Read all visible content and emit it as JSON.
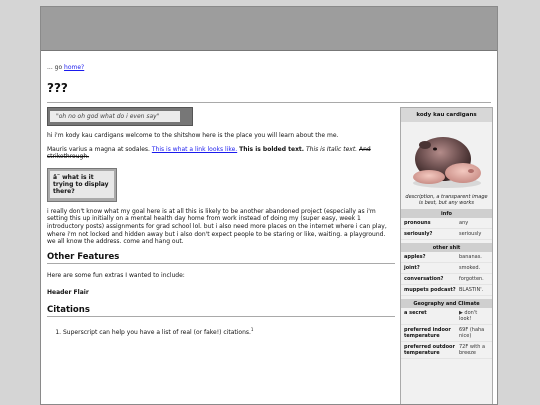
{
  "breadcrumb": {
    "prefix": "... go",
    "link": "home?"
  },
  "page": {
    "title": "???"
  },
  "callout": {
    "text": "\"oh no oh god what do i even say\""
  },
  "intro": "hi i'm kody kau cardigans welcome to the shitshow here is the place you will learn about the me.",
  "sample": {
    "plain": "Mauris varius a magna at sodales.",
    "link": "This is what a link looks like.",
    "bold": "This is bolded text.",
    "italic": "This is Italic text.",
    "strike": "And strikethrough."
  },
  "note": {
    "text": "â˜ what is it trying to display there?"
  },
  "body_para": "i really don't know what my goal here is at all this is likely to be another abandoned project (especially as i'm setting this up initially on a mental health day home from work instead of doing my (super easy, week 1 introductory posts) assignments for grad school lol. but i also need more places on the internet where i can play, where i'm not locked and hidden away but i also don't expect people to be staring or like, waiting. a playground. we all know the address. come and hang out.",
  "features": {
    "heading": "Other Features",
    "intro": "Here are some fun extras I wanted to include:",
    "subheading": "Header Flair"
  },
  "citations": {
    "heading": "Citations",
    "item": "Superscript can help you have a list of real (or fake!) citations.",
    "sup": "1"
  },
  "infobox": {
    "title": "kody kau cardigans",
    "caption": "description, a transparent image is best, but any works",
    "sections": [
      {
        "label": "info",
        "rows": [
          {
            "key": "pronouns",
            "value": "any"
          },
          {
            "key": "seriously?",
            "value": "seriously"
          }
        ]
      },
      {
        "label": "other shit",
        "rows": [
          {
            "key": "apples?",
            "value": "bananas."
          },
          {
            "key": "joint?",
            "value": "smoked."
          },
          {
            "key": "conversation?",
            "value": "forgotten."
          },
          {
            "key": "muppets podcast?",
            "value": "BLASTIN'."
          }
        ]
      },
      {
        "label": "Geography and Climate",
        "rows": [
          {
            "key": "a secret",
            "value": "▶ don't look!"
          },
          {
            "key": "preferred indoor temperature",
            "value": "69F (haha nice)"
          },
          {
            "key": "preferred outdoor temperature",
            "value": "72F with a breeze"
          }
        ]
      }
    ]
  },
  "colors": {
    "banner": "#9d9d9d",
    "link": "#1a1aee",
    "infobox_header": "#d7d7d7"
  }
}
